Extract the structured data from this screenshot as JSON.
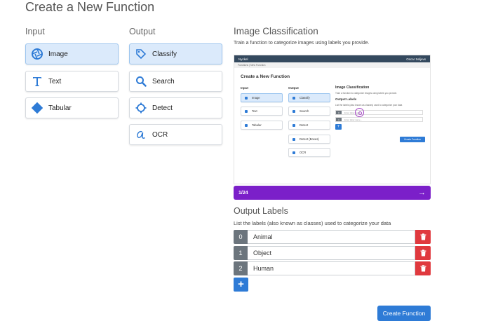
{
  "page": {
    "title": "Create a New Function"
  },
  "input": {
    "label": "Input",
    "options": [
      {
        "label": "Image",
        "icon": "aperture-icon",
        "selected": true
      },
      {
        "label": "Text",
        "icon": "text-icon",
        "selected": false
      },
      {
        "label": "Tabular",
        "icon": "tabular-icon",
        "selected": false
      }
    ]
  },
  "output": {
    "label": "Output",
    "options": [
      {
        "label": "Classify",
        "icon": "tag-icon",
        "selected": true
      },
      {
        "label": "Search",
        "icon": "search-icon",
        "selected": false
      },
      {
        "label": "Detect",
        "icon": "detect-icon",
        "selected": false
      },
      {
        "label": "OCR",
        "icon": "ocr-icon",
        "selected": false
      }
    ]
  },
  "section": {
    "title": "Image Classification",
    "description": "Train a function to categorize images using labels you provide."
  },
  "preview": {
    "brand": "Nyckel",
    "user": "Oscar Seljevs",
    "breadcrumb": "Functions | New Function",
    "title": "Create a New Function",
    "input_label": "Input",
    "output_label": "Output",
    "inputs": [
      "Image",
      "Text",
      "Tabular"
    ],
    "outputs": [
      "Classify",
      "Search",
      "Detect",
      "Detect (Boxes)",
      "OCR"
    ],
    "section_title": "Image Classification",
    "section_desc": "Train a function to categorize images using labels you provide.",
    "labels_title": "Output Labels",
    "labels_desc": "List the labels (also known as classes) used to categorize your data",
    "rows": [
      {
        "num": "0",
        "placeholder": "Enter label name"
      },
      {
        "num": "1",
        "placeholder": "Enter label name..."
      }
    ],
    "button": "Create Function"
  },
  "progress": {
    "count": "1/24",
    "arrow": "→"
  },
  "labels": {
    "title": "Output Labels",
    "description": "List the labels (also known as classes) used to categorize your data",
    "rows": [
      {
        "num": "0",
        "value": "Animal"
      },
      {
        "num": "1",
        "value": "Object"
      },
      {
        "num": "2",
        "value": "Human"
      }
    ],
    "add": "+"
  },
  "actions": {
    "create": "Create Function"
  },
  "colors": {
    "accent": "#2e7bd6",
    "selected_bg": "#dbeafb",
    "progress": "#7b1fc9",
    "danger": "#e0393e",
    "number_bg": "#6c757d"
  }
}
